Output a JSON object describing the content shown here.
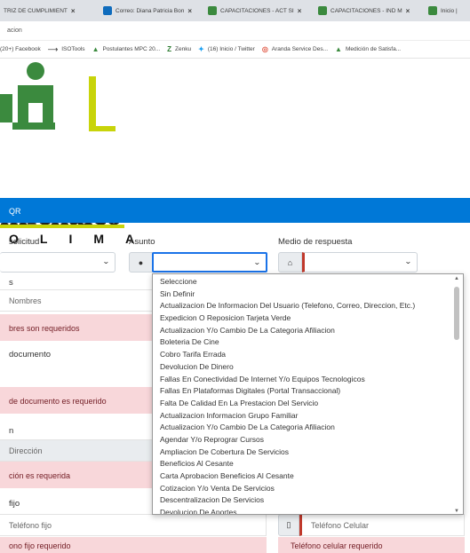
{
  "tabs": [
    {
      "label": "TRIZ DE CUMPLIMIENT",
      "icon": "none"
    },
    {
      "label": "Correo: Diana Patricia Bon",
      "icon": "outlook-icon"
    },
    {
      "label": "CAPACITACIONES - ACT SI",
      "icon": "bank-icon"
    },
    {
      "label": "CAPACITACIONES - IND M",
      "icon": "bank-icon"
    },
    {
      "label": "Inicio |",
      "icon": "bank-icon"
    }
  ],
  "address": "acion",
  "bookmarks": [
    "(20+) Facebook",
    "ISOTools",
    "Postulantes MPC 20...",
    "Zenku",
    "(16) Inicio / Twitter",
    "Aranda Service Des...",
    "Medición de Satisfa..."
  ],
  "logo": {
    "word": "mfenalco",
    "sub": "OLIMA"
  },
  "header": {
    "title": "QR"
  },
  "form": {
    "solicitud_label": "solicitud",
    "asunto_label": "Asunto",
    "medio_label": "Medio de respuesta",
    "s_label": "s",
    "nombres_placeholder": "Nombres",
    "nombres_error": "bres son requeridos",
    "documento_label": "documento",
    "documento_error": "de documento es requerido",
    "n_label": "n",
    "direccion_placeholder": "Dirección",
    "direccion_error": "ción es requerida",
    "fijo_label": "fijo",
    "telefono_fijo_placeholder": "Teléfono fijo",
    "telefono_celular_placeholder": "Teléfono Celular",
    "telefono_fijo_error": "ono fijo requerido",
    "telefono_celular_error": "Teléfono celular requerido"
  },
  "asunto_options": [
    "Seleccione",
    "Sin Definir",
    "Actualizacion De Informacion Del Usuario (Telefono, Correo, Direccion, Etc.)",
    "Expedicion O Reposicion Tarjeta Verde",
    "Actualizacion Y/o Cambio De La Categoria Afiliacion",
    "Boleteria De Cine",
    "Cobro Tarifa Errada",
    "Devolucion De Dinero",
    "Fallas En Conectividad De Internet Y/o Equipos Tecnologicos",
    "Fallas En Plataformas Digitales (Portal Transaccional)",
    "Falta De Calidad En La Prestacion Del Servicio",
    "Actualizacion Informacion Grupo Familiar",
    "Actualizacion Y/o Cambio De La Categoria Afiliacion",
    "Agendar Y/o Reprograr Cursos",
    "Ampliacion De Cobertura De Servicios",
    "Beneficios Al Cesante",
    "Carta Aprobacion Beneficios Al Cesante",
    "Cotizacion Y/o Venta De Servicios",
    "Descentralizacion De Servicios",
    "Devolucion De Aportes"
  ],
  "colors": {
    "header_blue": "#0078d7",
    "error_bg": "#f8d7da",
    "logo_green": "#3b8a3e",
    "logo_lime": "#c8d40a",
    "medio_accent": "#c0392b"
  }
}
